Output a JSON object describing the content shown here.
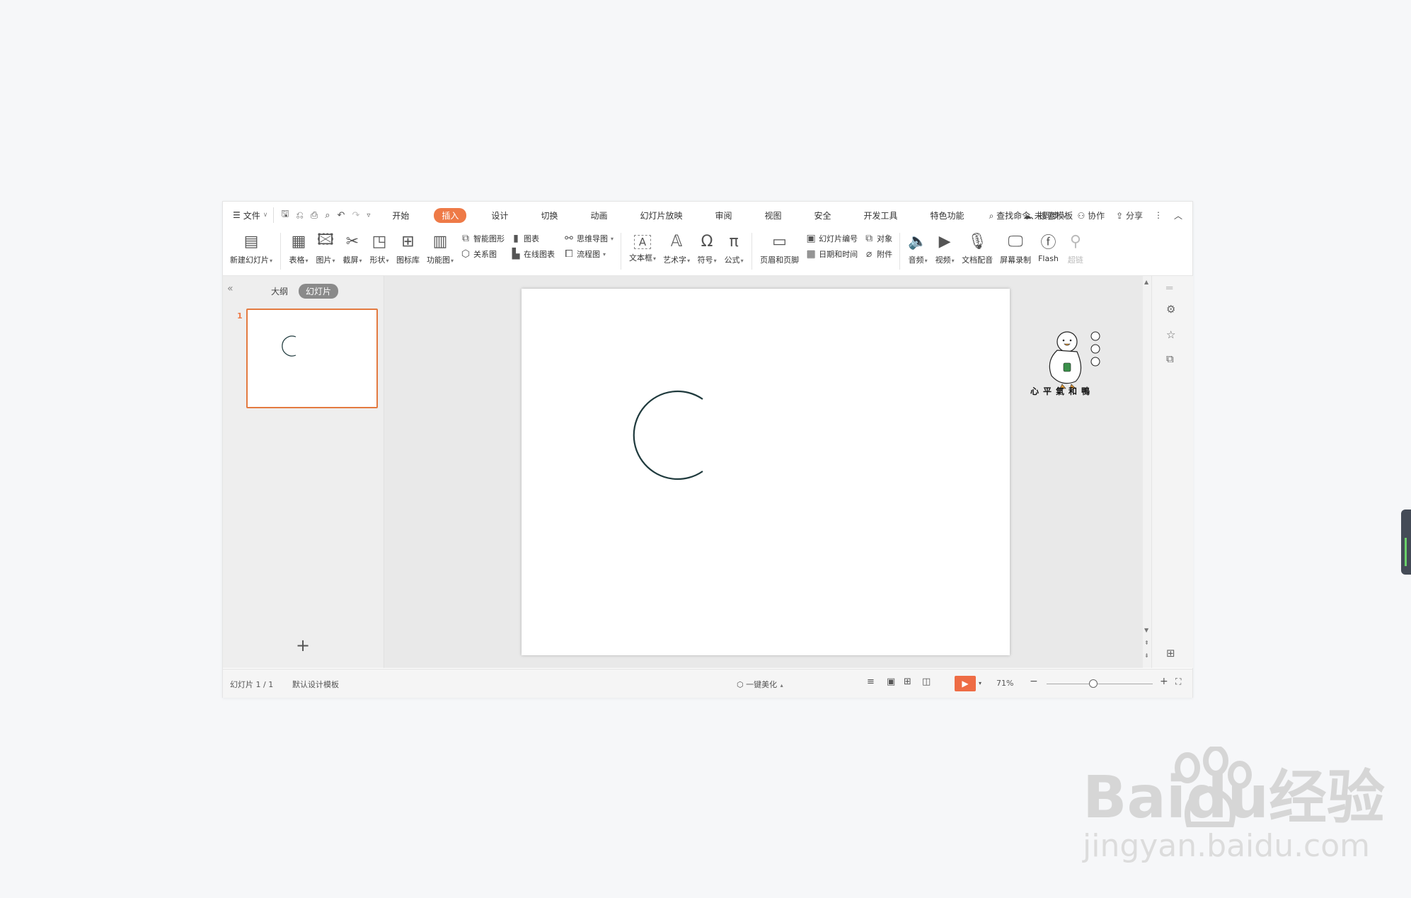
{
  "menubar": {
    "file_label": "文件",
    "tabs": [
      "开始",
      "插入",
      "设计",
      "切换",
      "动画",
      "幻灯片放映",
      "审阅",
      "视图",
      "安全",
      "开发工具",
      "特色功能"
    ],
    "active_tab": "插入",
    "search_placeholder": "查找命令、搜索模板",
    "sync_label": "未同步",
    "collab_label": "协作",
    "share_label": "分享"
  },
  "ribbon": {
    "new_slide": "新建幻灯片",
    "table": "表格",
    "picture": "图片",
    "screenshot": "截屏",
    "shape": "形状",
    "icon_library": "图标库",
    "function_chart": "功能图",
    "smart_graphic": "智能图形",
    "chart": "图表",
    "relation_chart": "关系图",
    "online_chart": "在线图表",
    "mind_map": "思维导图",
    "flow_chart": "流程图",
    "textbox": "文本框",
    "wordart": "艺术字",
    "symbol": "符号",
    "formula": "公式",
    "header_footer": "页眉和页脚",
    "slide_number": "幻灯片编号",
    "object": "对象",
    "date_time": "日期和时间",
    "attachment": "附件",
    "audio": "音频",
    "video": "视频",
    "doc_voiceover": "文档配音",
    "screen_record": "屏幕录制",
    "flash": "Flash",
    "hyperlink": "超链"
  },
  "leftpanel": {
    "outline_tab": "大纲",
    "slides_tab": "幻灯片",
    "slide_number": "1"
  },
  "status": {
    "slide_count": "幻灯片 1 / 1",
    "template": "默认设计模板",
    "beautify": "一键美化",
    "zoom": "71%"
  },
  "logo": {
    "text": "心平氣和鴨"
  },
  "watermark": {
    "brand": "Baidu经验",
    "url": "jingyan.baidu.com"
  },
  "colors": {
    "accent": "#ee7a47",
    "arc_stroke": "#1f3a3d"
  }
}
